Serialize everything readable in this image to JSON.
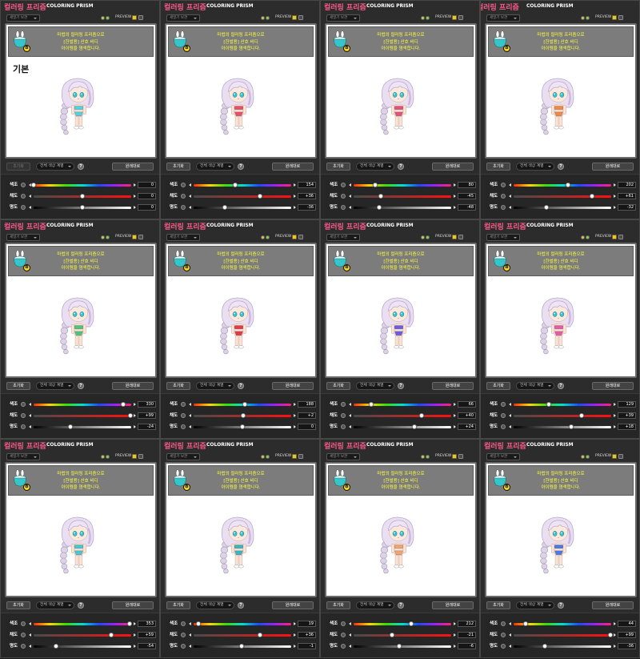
{
  "window": {
    "title_ko": "컬러링 프리즘",
    "title_en": "COLORING PRISM",
    "outfit_select": "세일기 보관",
    "preview_label": "PREVIEW"
  },
  "info": {
    "line1": "마법의 컬러링 프리즘으로",
    "line2": "[한벌용] 산호 비디",
    "line3": "아이템을 염색합니다.",
    "badge": "B"
  },
  "controls": {
    "reset": "초기화",
    "color_range": "전체 색상 계열",
    "help": "?",
    "revert": "원래대로"
  },
  "slider_labels": {
    "hue": "색조",
    "saturation": "채도",
    "brightness": "명도"
  },
  "panels": [
    {
      "label": "기본",
      "hue": "0",
      "saturation": "0",
      "brightness": "0",
      "suit_color": "#4fd3e3",
      "reset_disabled": true
    },
    {
      "hue": "154",
      "saturation": "+36",
      "brightness": "-36",
      "suit_color": "#e8506a"
    },
    {
      "hue": "80",
      "saturation": "-45",
      "brightness": "-48",
      "suit_color": "#e4507c"
    },
    {
      "hue": "202",
      "saturation": "+61",
      "brightness": "-32",
      "suit_color": "#f0884a"
    },
    {
      "hue": "330",
      "saturation": "+99",
      "brightness": "-24",
      "suit_color": "#4cc47a"
    },
    {
      "hue": "188",
      "saturation": "+2",
      "brightness": "0",
      "suit_color": "#e23a4a"
    },
    {
      "hue": "66",
      "saturation": "+40",
      "brightness": "+24",
      "suit_color": "#6a5ce6"
    },
    {
      "hue": "129",
      "saturation": "+39",
      "brightness": "+18",
      "suit_color": "#e65aa8"
    },
    {
      "hue": "353",
      "saturation": "+59",
      "brightness": "-54",
      "suit_color": "#45c8d6"
    },
    {
      "hue": "19",
      "saturation": "+36",
      "brightness": "-1",
      "suit_color": "#38b6c6"
    },
    {
      "hue": "212",
      "saturation": "-21",
      "brightness": "-6",
      "suit_color": "#f2a372"
    },
    {
      "hue": "44",
      "saturation": "+99",
      "brightness": "-36",
      "suit_color": "#4a78e6"
    }
  ]
}
